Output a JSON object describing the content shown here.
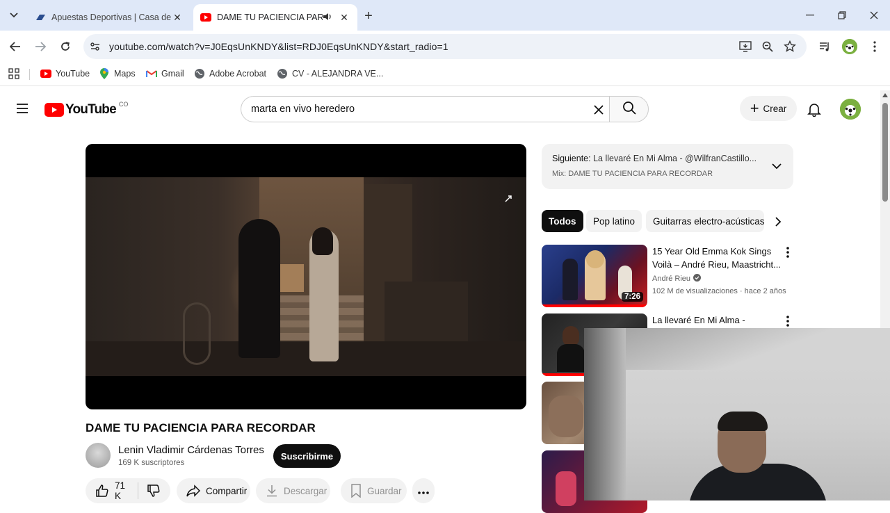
{
  "browser": {
    "tabs": [
      {
        "title": "Apuestas Deportivas | Casa de Apuestas",
        "active": false
      },
      {
        "title": "DAME TU PACIENCIA PARA RECORDAR",
        "active": true,
        "audio": true
      }
    ],
    "url": "youtube.com/watch?v=J0EqsUnKNDY&list=RDJ0EqsUnKNDY&start_radio=1",
    "bookmarks": [
      "YouTube",
      "Maps",
      "Gmail",
      "Adobe Acrobat",
      "CV - ALEJANDRA VE..."
    ]
  },
  "youtube": {
    "logo_text": "YouTube",
    "country_code": "CO",
    "search_query": "marta en vivo heredero",
    "create_label": "Crear"
  },
  "video": {
    "title": "DAME TU PACIENCIA PARA RECORDAR",
    "channel": "Lenin Vladimir Cárdenas Torres",
    "subscribers": "169 K suscriptores",
    "subscribe_label": "Suscribirme",
    "likes": "71 K",
    "share_label": "Compartir",
    "download_label": "Descargar",
    "save_label": "Guardar"
  },
  "playlist": {
    "next_label": "Siguiente:",
    "next_title": "La llevaré En Mi Alma - @WilfranCastillo...",
    "mix_label": "Mix: DAME TU PACIENCIA PARA RECORDAR"
  },
  "chips": [
    "Todos",
    "Pop latino",
    "Guitarras electro-acústicas"
  ],
  "recommendations": [
    {
      "title": "15 Year Old Emma Kok Sings Voilà – André Rieu, Maastricht...",
      "channel": "André Rieu",
      "verified": true,
      "meta": "102 M de visualizaciones · hace 2 años",
      "duration": "7:26"
    },
    {
      "title": "La llevaré En Mi Alma -",
      "channel": "",
      "meta": "",
      "duration": ""
    }
  ],
  "colors": {
    "yt_red": "#ff0000",
    "chrome_tabstrip": "#dfe8f8",
    "chip_bg": "#f2f2f2"
  }
}
